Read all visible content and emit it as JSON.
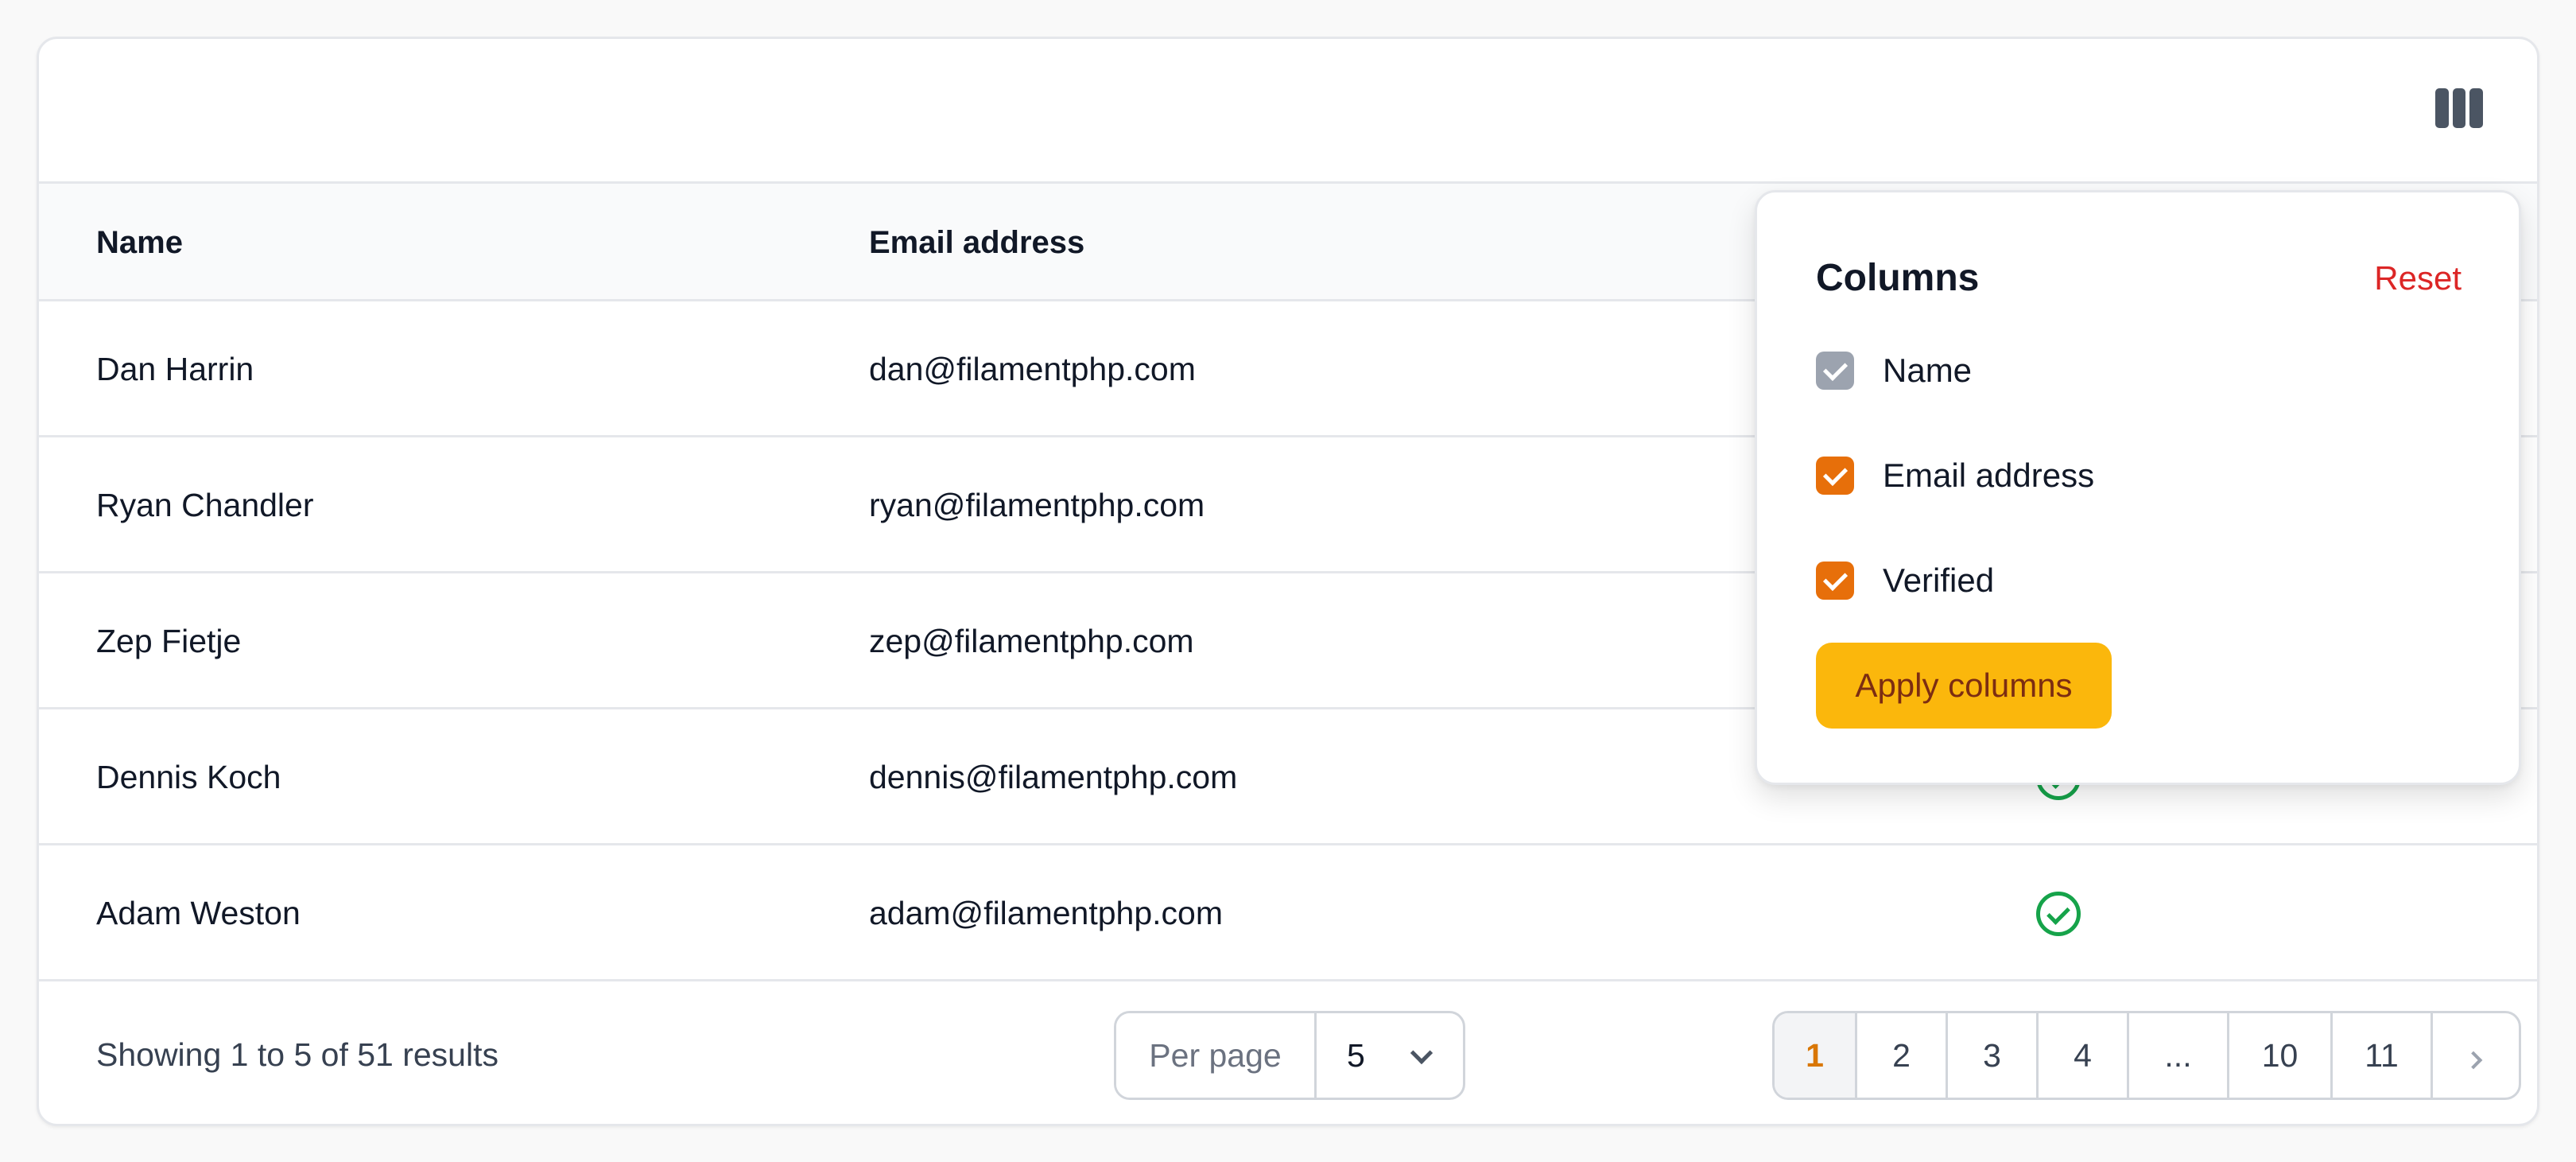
{
  "table": {
    "columns": {
      "name": "Name",
      "email": "Email address"
    },
    "rows": [
      {
        "name": "Dan Harrin",
        "email": "dan@filamentphp.com",
        "verified": true
      },
      {
        "name": "Ryan Chandler",
        "email": "ryan@filamentphp.com",
        "verified": true
      },
      {
        "name": "Zep Fietje",
        "email": "zep@filamentphp.com",
        "verified": true
      },
      {
        "name": "Dennis Koch",
        "email": "dennis@filamentphp.com",
        "verified": true
      },
      {
        "name": "Adam Weston",
        "email": "adam@filamentphp.com",
        "verified": true
      }
    ]
  },
  "toolbar": {
    "column_toggle_icon": "columns-icon"
  },
  "column_manager": {
    "title": "Columns",
    "reset_label": "Reset",
    "options": [
      {
        "label": "Name",
        "checked": true,
        "disabled": true
      },
      {
        "label": "Email address",
        "checked": true,
        "disabled": false
      },
      {
        "label": "Verified",
        "checked": true,
        "disabled": false
      }
    ],
    "apply_label": "Apply columns"
  },
  "footer": {
    "results_text": "Showing 1 to 5 of 51 results",
    "per_page_label": "Per page",
    "per_page_value": "5",
    "pages": [
      "1",
      "2",
      "3",
      "4",
      "...",
      "10",
      "11"
    ],
    "current_page": "1"
  },
  "colors": {
    "accent": "#e76f0a",
    "primary_button": "#fbb70c",
    "danger": "#dc2626",
    "success": "#16a34a"
  }
}
